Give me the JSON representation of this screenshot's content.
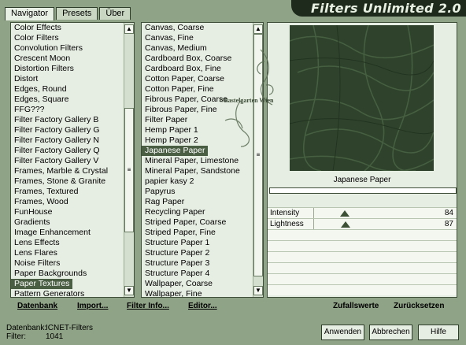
{
  "app": {
    "title": "Filters Unlimited 2.0"
  },
  "tabs": [
    {
      "label": "Navigator",
      "active": true
    },
    {
      "label": "Presets",
      "active": false
    },
    {
      "label": "Über",
      "active": false
    }
  ],
  "categories": {
    "selected_index": 25,
    "items": [
      "Color Effects",
      "Color Filters",
      "Convolution Filters",
      "Crescent Moon",
      "Distortion Filters",
      "Distort",
      "Edges, Round",
      "Edges, Square",
      "FFG???",
      "Filter Factory Gallery B",
      "Filter Factory Gallery G",
      "Filter Factory Gallery N",
      "Filter Factory Gallery Q",
      "Filter Factory Gallery V",
      "Frames, Marble & Crystal",
      "Frames, Stone & Granite",
      "Frames, Textured",
      "Frames, Wood",
      "FunHouse",
      "Gradients",
      "Image Enhancement",
      "Lens Effects",
      "Lens Flares",
      "Noise Filters",
      "Paper Backgrounds",
      "Paper Textures",
      "Pattern Generators"
    ]
  },
  "filters": {
    "selected_index": 12,
    "items": [
      "Canvas, Coarse",
      "Canvas, Fine",
      "Canvas, Medium",
      "Cardboard Box, Coarse",
      "Cardboard Box, Fine",
      "Cotton Paper, Coarse",
      "Cotton Paper, Fine",
      "Fibrous Paper, Coarse",
      "Fibrous Paper, Fine",
      "Filter Paper",
      "Hemp Paper 1",
      "Hemp Paper 2",
      "Japanese Paper",
      "Mineral Paper, Limestone",
      "Mineral Paper, Sandstone",
      "papier kasy 2",
      "Papyrus",
      "Rag Paper",
      "Recycling Paper",
      "Striped Paper, Coarse",
      "Striped Paper, Fine",
      "Structure Paper 1",
      "Structure Paper 2",
      "Structure Paper 3",
      "Structure Paper 4",
      "Wallpaper, Coarse",
      "Wallpaper, Fine"
    ]
  },
  "preview": {
    "name": "Japanese Paper",
    "watermark": "©Bastelgarten Wien"
  },
  "sliders": [
    {
      "label": "Intensity",
      "value": "84",
      "level": 84
    },
    {
      "label": "Lightness",
      "value": "87",
      "level": 87
    }
  ],
  "bottom_links": {
    "datenbank": "Datenbank",
    "import": "Import...",
    "filter_info": "Filter Info...",
    "editor": "Editor...",
    "zufallswerte": "Zufallswerte",
    "zuruecksetzen": "Zurücksetzen"
  },
  "status": {
    "db_key": "Datenbank:",
    "db_val": "ICNET-Filters",
    "filter_key": "Filter:",
    "filter_val": "1041"
  },
  "buttons": {
    "apply": "Anwenden",
    "cancel": "Abbrechen",
    "help": "Hilfe"
  },
  "colors": {
    "background": "#8fa386",
    "panel": "#e6ede2",
    "selection": "#4a5e43",
    "preview": "#2f432c"
  }
}
